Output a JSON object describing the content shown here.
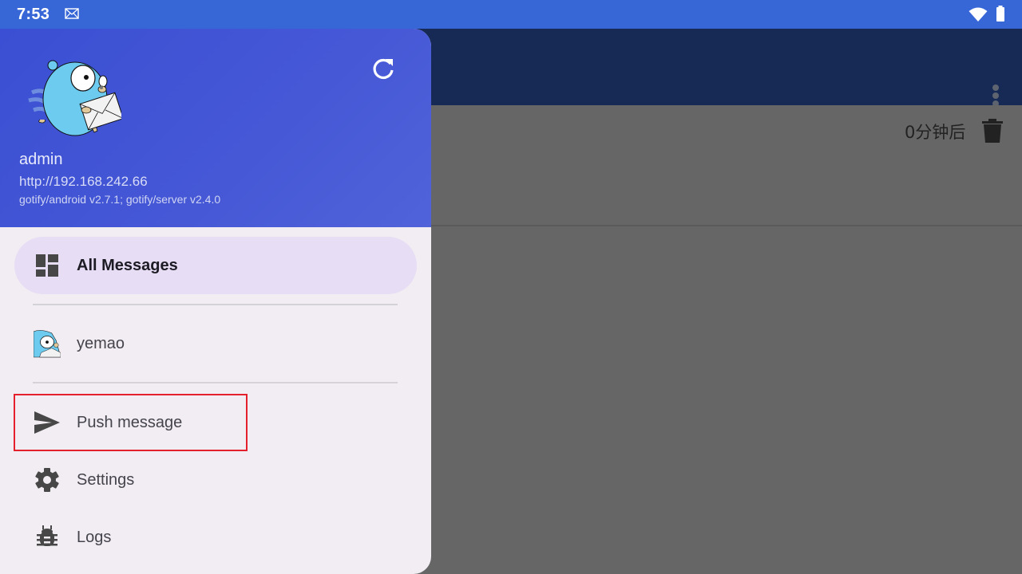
{
  "status_bar": {
    "time": "7:53",
    "notification_icon": "mail-icon",
    "wifi_icon": "wifi-icon",
    "battery_icon": "battery-icon"
  },
  "app_bar": {
    "overflow_icon": "more-vert-icon"
  },
  "message_list": {
    "items": [
      {
        "time": "0分钟后",
        "delete_icon": "delete-icon"
      }
    ]
  },
  "drawer": {
    "header": {
      "avatar": "gopher-mascot",
      "username": "admin",
      "server_url": "http://192.168.242.66",
      "version": "gotify/android v2.7.1; gotify/server v2.4.0",
      "refresh_icon": "refresh-icon"
    },
    "items": [
      {
        "label": "All Messages",
        "icon": "dashboard-icon",
        "active": true
      },
      {
        "label": "yemao",
        "icon": "app-gopher-icon",
        "active": false
      },
      {
        "label": "Push message",
        "icon": "send-icon",
        "active": false
      },
      {
        "label": "Settings",
        "icon": "gear-icon",
        "active": false
      },
      {
        "label": "Logs",
        "icon": "bug-icon",
        "active": false
      }
    ]
  },
  "colors": {
    "status_bar": "#3766d6",
    "app_bar": "#172955",
    "drawer_header": "#4658d6",
    "drawer_bg": "#f2edf2",
    "active_item_bg": "#e7ddf5",
    "highlight": "#e3202b",
    "scrim": "#666666"
  }
}
